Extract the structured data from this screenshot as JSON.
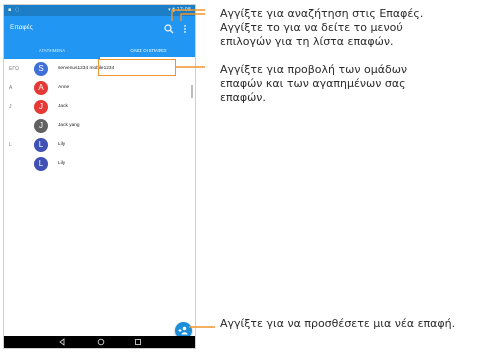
{
  "statusbar": {
    "left": "▪ ◌",
    "right": "▾ ▮ 17:08"
  },
  "appbar": {
    "title": "Επαφές"
  },
  "tabs": [
    {
      "label": "ΑΓΑΠΗΜΕΝΑ",
      "selected": false
    },
    {
      "label": "ΟΛΕΣ ΟΙ ΕΠΑΦΕΣ",
      "selected": true
    }
  ],
  "contacts": [
    {
      "section": "ΕΓΩ",
      "initial": "S",
      "name": "servenus1234 mobile1234",
      "color": "#3f6fd8"
    },
    {
      "section": "A",
      "initial": "A",
      "name": "Anne",
      "color": "#e53935"
    },
    {
      "section": "J",
      "initial": "J",
      "name": "Jack",
      "color": "#e53935"
    },
    {
      "section": "",
      "initial": "J",
      "name": "Jack yang",
      "color": "#616161"
    },
    {
      "section": "L",
      "initial": "L",
      "name": "Lily",
      "color": "#3f51b5"
    },
    {
      "section": "",
      "initial": "L",
      "name": "Lily",
      "color": "#3f51b5"
    }
  ],
  "annotations": {
    "search": "Αγγίξτε για αναζήτηση στις Επαφές.",
    "menu": [
      "Αγγίξτε το για να δείτε το μενού",
      "επιλογών για τη λίστα επαφών."
    ],
    "groups": [
      "Αγγίξτε για προβολή των ομάδων",
      "επαφών και των αγαπημένων σας",
      "επαφών."
    ],
    "add": "Αγγίξτε για να προσθέσετε μια νέα επαφή."
  },
  "colors": {
    "primary": "#2196f3",
    "statusbar": "#1b7ec6",
    "callout": "#f0962c",
    "fab": "#1d8ed8"
  }
}
